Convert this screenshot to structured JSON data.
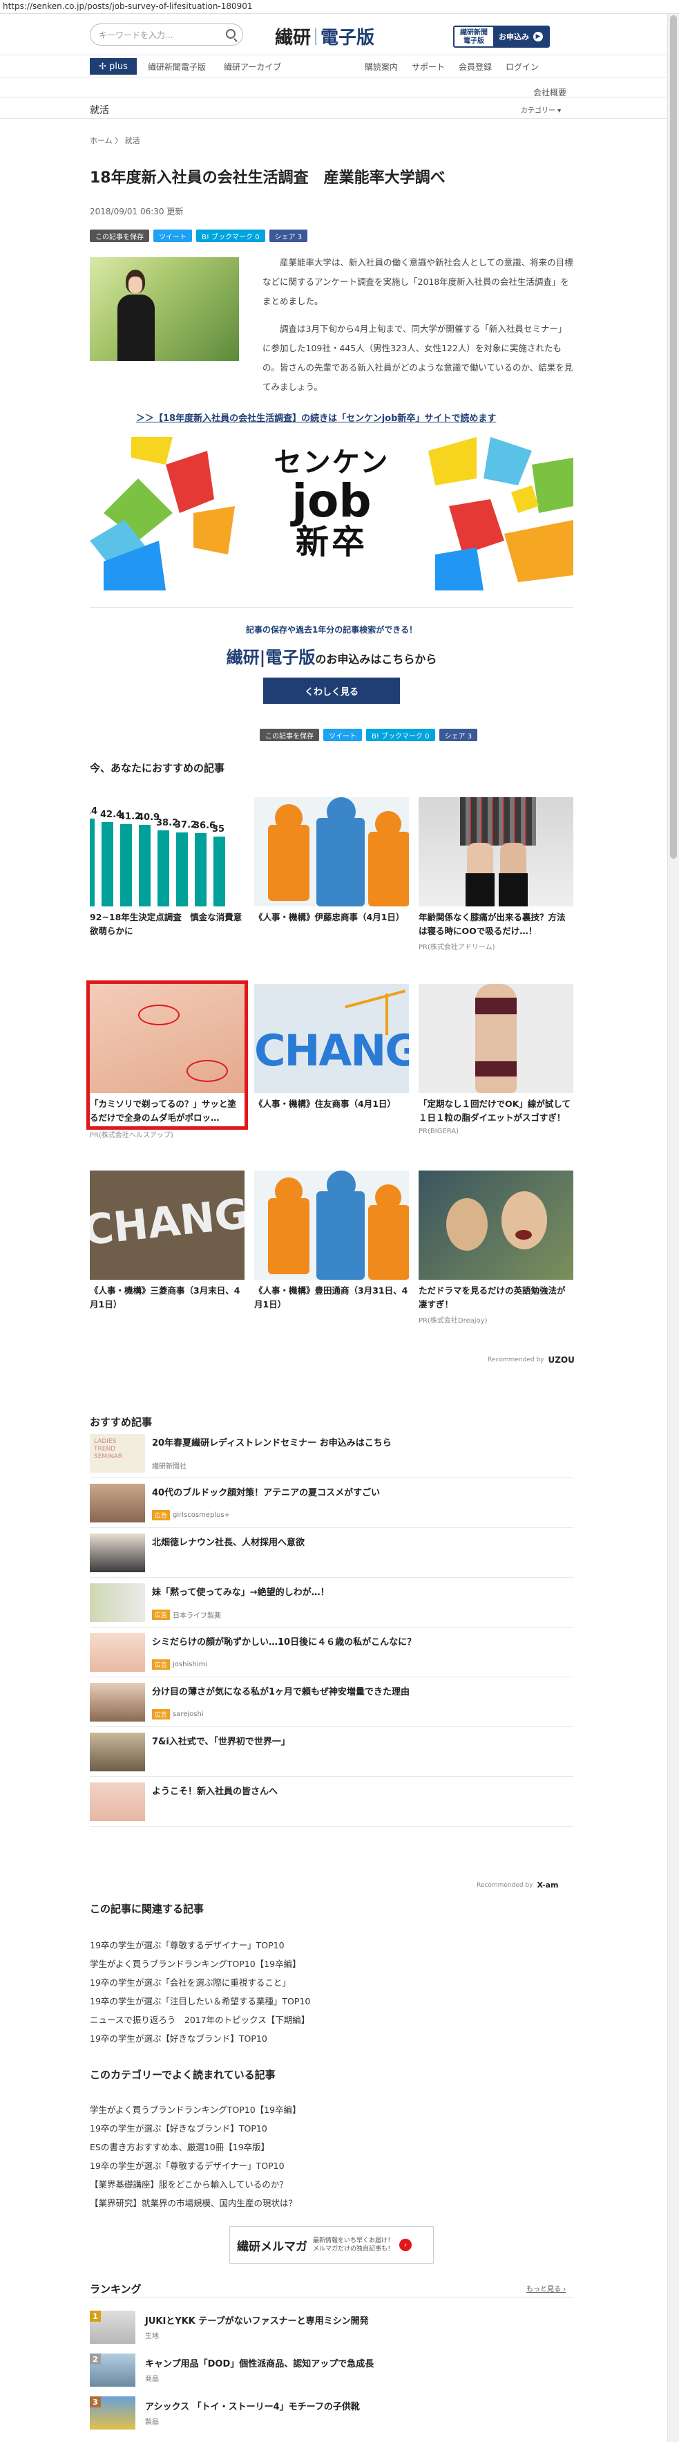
{
  "url": "https://senken.co.jp/posts/job-survey-of-lifesituation-180901",
  "header": {
    "search_placeholder": "キーワードを入力...",
    "logo_left": "繊研",
    "logo_right": "電子版",
    "subscribe_small": "繊研新聞\n電子版",
    "subscribe_label": "お申込み"
  },
  "nav": {
    "plus": "plus",
    "left": [
      "繊研新聞電子版",
      "繊研アーカイブ"
    ],
    "right": [
      "購読案内",
      "サポート",
      "会員登録",
      "ログイン"
    ],
    "right2": "会社概要"
  },
  "section": {
    "name": "就活",
    "category": "カテゴリー ▾"
  },
  "breadcrumb": "ホーム  〉 就活",
  "article": {
    "title": "18年度新入社員の会社生活調査　産業能率大学調べ",
    "date": "2018/09/01 06:30 更新",
    "share": {
      "save": "この記事を保存",
      "tweet": "ツイート",
      "hatena": "B! ブックマーク 0",
      "facebook": "シェア 3"
    },
    "lead_p1": "産業能率大学は、新入社員の働く意識や新社会人としての意識、将来の目標などに関するアンケート調査を実施し「2018年度新入社員の会社生活調査」をまとめました。",
    "lead_p2": "調査は3月下旬から4月上旬まで、同大学が開催する「新入社員セミナー」に参加した109社・445人（男性323人、女性122人）を対象に実施されたもの。皆さんの先輩である新入社員がどのような意識で働いているのか、結果を見てみましょう。",
    "more_link": "＞＞【18年度新入社員の会社生活調査】の続きは「センケンjob新卒」サイトで読めます",
    "banner_lines": [
      "センケン",
      "job",
      "新卒"
    ]
  },
  "promo": {
    "small": "記事の保存や過去1年分の記事検索ができる！",
    "logo": "繊研|電子版",
    "big_suffix": "のお申込みはこちらから",
    "button": "くわしく見る"
  },
  "recommend": {
    "heading": "今、あなたにおすすめの記事",
    "chart_labels": [
      "0.4",
      "42.4",
      "41.2",
      "40.9",
      "38.2",
      "37.2",
      "36.6",
      "35"
    ],
    "cards": [
      {
        "caption": "92~18年生決定点調査　慎金な消費意欲萌らかに",
        "pr": ""
      },
      {
        "caption": "《人事・機構》伊藤忠商事（4月1日）",
        "pr": ""
      },
      {
        "caption": "年齢関係なく膝痛が出来る裏技？方法は寝る時にOOで吸るだけ…！",
        "pr": "PR(株式会社アドリーム)"
      },
      {
        "caption": "「カミソリで剃ってるの？」サッと塗るだけで全身のムダ毛がポロッ…",
        "pr": "PR(株式会社ヘルスアップ)"
      },
      {
        "caption": "《人事・機構》住友商事（4月1日）",
        "pr": ""
      },
      {
        "caption": "「定期なし１回だけでOK」線が試して１日１粒の脂ダイエットがスゴすぎ！",
        "pr": "PR(BIGERA)"
      },
      {
        "caption": "《人事・機構》三菱商事（3月末日、4月1日）",
        "pr": ""
      },
      {
        "caption": "《人事・機構》豊田通商（3月31日、4月1日）",
        "pr": ""
      },
      {
        "caption": "ただドラマを見るだけの英語勉強法が凄すぎ！",
        "pr": "PR(株式会社Dreajoy)"
      }
    ],
    "change_text": "CHANG",
    "recommended_by": "Recommended by",
    "uzou": "UZOU"
  },
  "osusume": {
    "heading": "おすすめ記事",
    "items": [
      {
        "title": "20年春夏繊研レディストレンドセミナー お申込みはこちら",
        "tag": "",
        "src": "繊研新聞社"
      },
      {
        "title": "40代のブルドック顔対策！アテニアの夏コスメがすごい",
        "tag": "広告",
        "src": "girlscosmeplus+"
      },
      {
        "title": "北畑徳レナウン社長、人材採用へ意欲",
        "tag": "",
        "src": ""
      },
      {
        "title": "妹「黙って使ってみな」→絶望的しわが…！",
        "tag": "広告",
        "src": "日本ライフ製薬"
      },
      {
        "title": "シミだらけの顔が恥ずかしい…10日後に４６歳の私がこんなに？",
        "tag": "広告",
        "src": "joshishimi"
      },
      {
        "title": "分け目の薄さが気になる私が1ヶ月で頼もぜ神安増量できた理由",
        "tag": "広告",
        "src": "sarejoshi"
      },
      {
        "title": "7&i入社式で、「世界初で世界一」",
        "tag": "",
        "src": ""
      },
      {
        "title": "ようこそ！新入社員の皆さんへ",
        "tag": "",
        "src": ""
      }
    ],
    "recommended_by": "Recommended by",
    "xamp": "X-am"
  },
  "related": {
    "heading": "この記事に関連する記事",
    "items": [
      "19卒の学生が選ぶ「尊敬するデザイナー」TOP10",
      "学生がよく買うブランドランキングTOP10【19卒編】",
      "19卒の学生が選ぶ「会社を選ぶ際に重視すること」",
      "19卒の学生が選ぶ「注目したい＆希望する業種」TOP10",
      "ニュースで振り返ろう　2017年のトピックス【下期編】",
      "19卒の学生が選ぶ【好きなブランド】TOP10"
    ]
  },
  "popular": {
    "heading": "このカテゴリーでよく読まれている記事",
    "items": [
      "学生がよく買うブランドランキングTOP10【19卒編】",
      "19卒の学生が選ぶ【好きなブランド】TOP10",
      "ESの書き方おすすめ本、厳選10冊【19卒版】",
      "19卒の学生が選ぶ「尊敬するデザイナー」TOP10",
      "【業界基礎講座】服をどこから輸入しているのか？",
      "【業界研究】就業界の市場規模、国内生産の現状は？"
    ]
  },
  "mail": {
    "logo": "繊研メルマガ",
    "text": "最新情報をいち早くお届け！\nメルマガだけの独自記事も！",
    "arrow": "›"
  },
  "ranking": {
    "heading": "ランキング",
    "more": "もっと見る ›",
    "items": [
      {
        "num": "1",
        "title": "JUKIとYKK テープがないファスナーと専用ミシン開発",
        "src": "生地"
      },
      {
        "num": "2",
        "title": "キャンプ用品「DOD」個性派商品、認知アップで急成長",
        "src": "商品"
      },
      {
        "num": "3",
        "title": "アシックス 「トイ・ストーリー4」モチーフの子供靴",
        "src": "製品"
      }
    ]
  },
  "colors": {
    "brand": "#1f3f74",
    "accent_red": "#e0181b",
    "teal": "#00a199"
  }
}
